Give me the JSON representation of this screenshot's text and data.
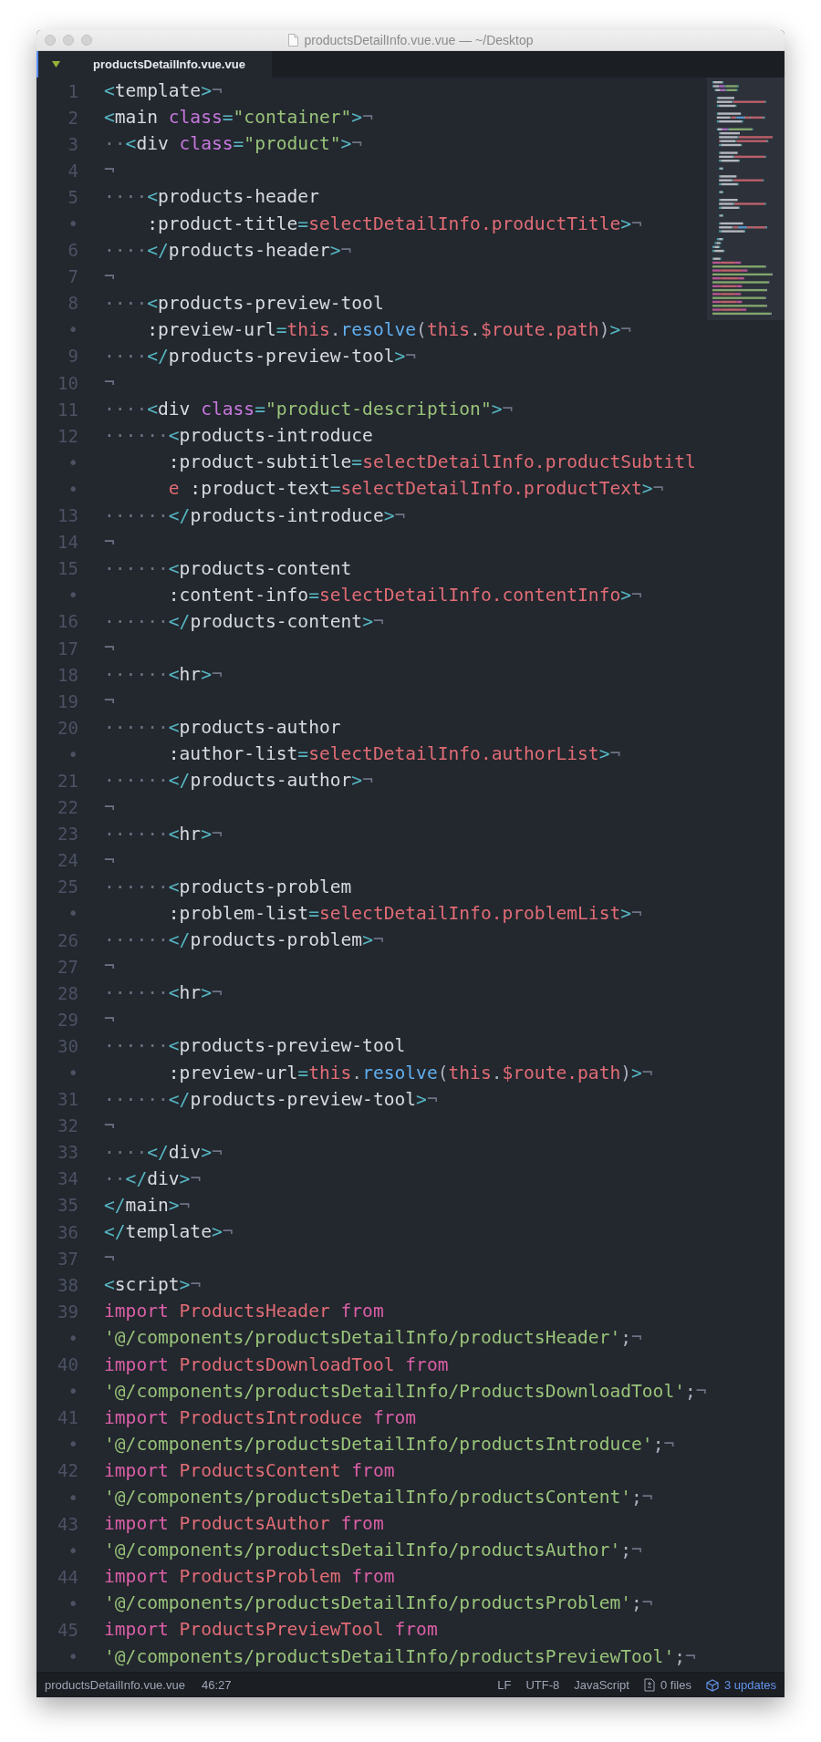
{
  "window": {
    "title": "productsDetailInfo.vue.vue — ~/Desktop"
  },
  "tabs": [
    {
      "label": "productsDetailInfo.vue.vue",
      "selected": true
    }
  ],
  "editor": {
    "rows": [
      {
        "n": "1",
        "c": [
          {
            "text": "<",
            "kind": "p"
          },
          {
            "text": "template",
            "kind": "tag"
          },
          {
            "text": ">",
            "kind": "p"
          },
          {
            "text": "¬",
            "kind": "eol"
          }
        ]
      },
      {
        "n": "2",
        "c": [
          {
            "text": "<",
            "kind": "p"
          },
          {
            "text": "main ",
            "kind": "tag"
          },
          {
            "text": "class",
            "kind": "attr"
          },
          {
            "text": "=",
            "kind": "p"
          },
          {
            "text": "\"container\"",
            "kind": "str"
          },
          {
            "text": ">",
            "kind": "p"
          },
          {
            "text": "¬",
            "kind": "eol"
          }
        ]
      },
      {
        "n": "3",
        "c": [
          {
            "text": "··",
            "kind": "ws"
          },
          {
            "text": "<",
            "kind": "p"
          },
          {
            "text": "div ",
            "kind": "tag"
          },
          {
            "text": "class",
            "kind": "attr"
          },
          {
            "text": "=",
            "kind": "p"
          },
          {
            "text": "\"product\"",
            "kind": "str"
          },
          {
            "text": ">",
            "kind": "p"
          },
          {
            "text": "¬",
            "kind": "eol"
          }
        ]
      },
      {
        "n": "4",
        "c": [
          {
            "text": "¬",
            "kind": "eol"
          }
        ]
      },
      {
        "n": "5",
        "c": [
          {
            "text": "····",
            "kind": "ws"
          },
          {
            "text": "<",
            "kind": "p"
          },
          {
            "text": "products-header",
            "kind": "tag"
          }
        ]
      },
      {
        "n": "•",
        "c": [
          {
            "text": ":product-title",
            "kind": "tag"
          },
          {
            "text": "=",
            "kind": "p"
          },
          {
            "text": "selectDetailInfo.productTitle",
            "kind": "var"
          },
          {
            "text": ">",
            "kind": "p"
          },
          {
            "text": "¬",
            "kind": "eol"
          }
        ]
      },
      {
        "n": "6",
        "c": [
          {
            "text": "····",
            "kind": "ws"
          },
          {
            "text": "</",
            "kind": "p"
          },
          {
            "text": "products-header",
            "kind": "tag"
          },
          {
            "text": ">",
            "kind": "p"
          },
          {
            "text": "¬",
            "kind": "eol"
          }
        ]
      },
      {
        "n": "7",
        "c": [
          {
            "text": "¬",
            "kind": "eol"
          }
        ]
      },
      {
        "n": "8",
        "c": [
          {
            "text": "····",
            "kind": "ws"
          },
          {
            "text": "<",
            "kind": "p"
          },
          {
            "text": "products-preview-tool",
            "kind": "tag"
          }
        ]
      },
      {
        "n": "•",
        "c": [
          {
            "text": ":preview-url",
            "kind": "tag"
          },
          {
            "text": "=",
            "kind": "p"
          },
          {
            "text": "this",
            "kind": "var"
          },
          {
            "text": ".",
            "kind": "txt"
          },
          {
            "text": "resolve",
            "kind": "fn"
          },
          {
            "text": "(",
            "kind": "txt"
          },
          {
            "text": "this",
            "kind": "var"
          },
          {
            "text": ".",
            "kind": "txt"
          },
          {
            "text": "$route.path",
            "kind": "var"
          },
          {
            "text": ")",
            "kind": "txt"
          },
          {
            "text": ">",
            "kind": "p"
          },
          {
            "text": "¬",
            "kind": "eol"
          }
        ]
      },
      {
        "n": "9",
        "c": [
          {
            "text": "····",
            "kind": "ws"
          },
          {
            "text": "</",
            "kind": "p"
          },
          {
            "text": "products-preview-tool",
            "kind": "tag"
          },
          {
            "text": ">",
            "kind": "p"
          },
          {
            "text": "¬",
            "kind": "eol"
          }
        ]
      },
      {
        "n": "10",
        "c": [
          {
            "text": "¬",
            "kind": "eol"
          }
        ]
      },
      {
        "n": "11",
        "c": [
          {
            "text": "····",
            "kind": "ws"
          },
          {
            "text": "<",
            "kind": "p"
          },
          {
            "text": "div ",
            "kind": "tag"
          },
          {
            "text": "class",
            "kind": "attr"
          },
          {
            "text": "=",
            "kind": "p"
          },
          {
            "text": "\"product-description\"",
            "kind": "str"
          },
          {
            "text": ">",
            "kind": "p"
          },
          {
            "text": "¬",
            "kind": "eol"
          }
        ]
      },
      {
        "n": "12",
        "c": [
          {
            "text": "······",
            "kind": "ws"
          },
          {
            "text": "<",
            "kind": "p"
          },
          {
            "text": "products-introduce",
            "kind": "tag"
          }
        ]
      },
      {
        "n": "•",
        "c": [
          {
            "text": ":product-subtitle",
            "kind": "tag"
          },
          {
            "text": "=",
            "kind": "p"
          },
          {
            "text": "selectDetailInfo.productSubtitl",
            "kind": "var"
          }
        ]
      },
      {
        "n": "•",
        "c": [
          {
            "text": "e",
            "kind": "var"
          },
          {
            "text": " :product-text",
            "kind": "tag"
          },
          {
            "text": "=",
            "kind": "p"
          },
          {
            "text": "selectDetailInfo.productText",
            "kind": "var"
          },
          {
            "text": ">",
            "kind": "p"
          },
          {
            "text": "¬",
            "kind": "eol"
          }
        ]
      },
      {
        "n": "13",
        "c": [
          {
            "text": "······",
            "kind": "ws"
          },
          {
            "text": "</",
            "kind": "p"
          },
          {
            "text": "products-introduce",
            "kind": "tag"
          },
          {
            "text": ">",
            "kind": "p"
          },
          {
            "text": "¬",
            "kind": "eol"
          }
        ]
      },
      {
        "n": "14",
        "c": [
          {
            "text": "¬",
            "kind": "eol"
          }
        ]
      },
      {
        "n": "15",
        "c": [
          {
            "text": "······",
            "kind": "ws"
          },
          {
            "text": "<",
            "kind": "p"
          },
          {
            "text": "products-content",
            "kind": "tag"
          }
        ]
      },
      {
        "n": "•",
        "c": [
          {
            "text": ":content-info",
            "kind": "tag"
          },
          {
            "text": "=",
            "kind": "p"
          },
          {
            "text": "selectDetailInfo.contentInfo",
            "kind": "var"
          },
          {
            "text": ">",
            "kind": "p"
          },
          {
            "text": "¬",
            "kind": "eol"
          }
        ]
      },
      {
        "n": "16",
        "c": [
          {
            "text": "······",
            "kind": "ws"
          },
          {
            "text": "</",
            "kind": "p"
          },
          {
            "text": "products-content",
            "kind": "tag"
          },
          {
            "text": ">",
            "kind": "p"
          },
          {
            "text": "¬",
            "kind": "eol"
          }
        ]
      },
      {
        "n": "17",
        "c": [
          {
            "text": "¬",
            "kind": "eol"
          }
        ]
      },
      {
        "n": "18",
        "c": [
          {
            "text": "······",
            "kind": "ws"
          },
          {
            "text": "<",
            "kind": "p"
          },
          {
            "text": "hr",
            "kind": "tag"
          },
          {
            "text": ">",
            "kind": "p"
          },
          {
            "text": "¬",
            "kind": "eol"
          }
        ]
      },
      {
        "n": "19",
        "c": [
          {
            "text": "¬",
            "kind": "eol"
          }
        ]
      },
      {
        "n": "20",
        "c": [
          {
            "text": "······",
            "kind": "ws"
          },
          {
            "text": "<",
            "kind": "p"
          },
          {
            "text": "products-author",
            "kind": "tag"
          }
        ]
      },
      {
        "n": "•",
        "c": [
          {
            "text": ":author-list",
            "kind": "tag"
          },
          {
            "text": "=",
            "kind": "p"
          },
          {
            "text": "selectDetailInfo.authorList",
            "kind": "var"
          },
          {
            "text": ">",
            "kind": "p"
          },
          {
            "text": "¬",
            "kind": "eol"
          }
        ]
      },
      {
        "n": "21",
        "c": [
          {
            "text": "······",
            "kind": "ws"
          },
          {
            "text": "</",
            "kind": "p"
          },
          {
            "text": "products-author",
            "kind": "tag"
          },
          {
            "text": ">",
            "kind": "p"
          },
          {
            "text": "¬",
            "kind": "eol"
          }
        ]
      },
      {
        "n": "22",
        "c": [
          {
            "text": "¬",
            "kind": "eol"
          }
        ]
      },
      {
        "n": "23",
        "c": [
          {
            "text": "······",
            "kind": "ws"
          },
          {
            "text": "<",
            "kind": "p"
          },
          {
            "text": "hr",
            "kind": "tag"
          },
          {
            "text": ">",
            "kind": "p"
          },
          {
            "text": "¬",
            "kind": "eol"
          }
        ]
      },
      {
        "n": "24",
        "c": [
          {
            "text": "¬",
            "kind": "eol"
          }
        ]
      },
      {
        "n": "25",
        "c": [
          {
            "text": "······",
            "kind": "ws"
          },
          {
            "text": "<",
            "kind": "p"
          },
          {
            "text": "products-problem",
            "kind": "tag"
          }
        ]
      },
      {
        "n": "•",
        "c": [
          {
            "text": ":problem-list",
            "kind": "tag"
          },
          {
            "text": "=",
            "kind": "p"
          },
          {
            "text": "selectDetailInfo.problemList",
            "kind": "var"
          },
          {
            "text": ">",
            "kind": "p"
          },
          {
            "text": "¬",
            "kind": "eol"
          }
        ]
      },
      {
        "n": "26",
        "c": [
          {
            "text": "······",
            "kind": "ws"
          },
          {
            "text": "</",
            "kind": "p"
          },
          {
            "text": "products-problem",
            "kind": "tag"
          },
          {
            "text": ">",
            "kind": "p"
          },
          {
            "text": "¬",
            "kind": "eol"
          }
        ]
      },
      {
        "n": "27",
        "c": [
          {
            "text": "¬",
            "kind": "eol"
          }
        ]
      },
      {
        "n": "28",
        "c": [
          {
            "text": "······",
            "kind": "ws"
          },
          {
            "text": "<",
            "kind": "p"
          },
          {
            "text": "hr",
            "kind": "tag"
          },
          {
            "text": ">",
            "kind": "p"
          },
          {
            "text": "¬",
            "kind": "eol"
          }
        ]
      },
      {
        "n": "29",
        "c": [
          {
            "text": "¬",
            "kind": "eol"
          }
        ]
      },
      {
        "n": "30",
        "c": [
          {
            "text": "······",
            "kind": "ws"
          },
          {
            "text": "<",
            "kind": "p"
          },
          {
            "text": "products-preview-tool",
            "kind": "tag"
          }
        ]
      },
      {
        "n": "•",
        "c": [
          {
            "text": ":preview-url",
            "kind": "tag"
          },
          {
            "text": "=",
            "kind": "p"
          },
          {
            "text": "this",
            "kind": "var"
          },
          {
            "text": ".",
            "kind": "txt"
          },
          {
            "text": "resolve",
            "kind": "fn"
          },
          {
            "text": "(",
            "kind": "txt"
          },
          {
            "text": "this",
            "kind": "var"
          },
          {
            "text": ".",
            "kind": "txt"
          },
          {
            "text": "$route.path",
            "kind": "var"
          },
          {
            "text": ")",
            "kind": "txt"
          },
          {
            "text": ">",
            "kind": "p"
          },
          {
            "text": "¬",
            "kind": "eol"
          }
        ]
      },
      {
        "n": "31",
        "c": [
          {
            "text": "······",
            "kind": "ws"
          },
          {
            "text": "</",
            "kind": "p"
          },
          {
            "text": "products-preview-tool",
            "kind": "tag"
          },
          {
            "text": ">",
            "kind": "p"
          },
          {
            "text": "¬",
            "kind": "eol"
          }
        ]
      },
      {
        "n": "32",
        "c": [
          {
            "text": "¬",
            "kind": "eol"
          }
        ]
      },
      {
        "n": "33",
        "c": [
          {
            "text": "····",
            "kind": "ws"
          },
          {
            "text": "</",
            "kind": "p"
          },
          {
            "text": "div",
            "kind": "tag"
          },
          {
            "text": ">",
            "kind": "p"
          },
          {
            "text": "¬",
            "kind": "eol"
          }
        ]
      },
      {
        "n": "34",
        "c": [
          {
            "text": "··",
            "kind": "ws"
          },
          {
            "text": "</",
            "kind": "p"
          },
          {
            "text": "div",
            "kind": "tag"
          },
          {
            "text": ">",
            "kind": "p"
          },
          {
            "text": "¬",
            "kind": "eol"
          }
        ]
      },
      {
        "n": "35",
        "c": [
          {
            "text": "</",
            "kind": "p"
          },
          {
            "text": "main",
            "kind": "tag"
          },
          {
            "text": ">",
            "kind": "p"
          },
          {
            "text": "¬",
            "kind": "eol"
          }
        ]
      },
      {
        "n": "36",
        "c": [
          {
            "text": "</",
            "kind": "p"
          },
          {
            "text": "template",
            "kind": "tag"
          },
          {
            "text": ">",
            "kind": "p"
          },
          {
            "text": "¬",
            "kind": "eol"
          }
        ]
      },
      {
        "n": "37",
        "c": [
          {
            "text": "¬",
            "kind": "eol"
          }
        ]
      },
      {
        "n": "38",
        "c": [
          {
            "text": "<",
            "kind": "p"
          },
          {
            "text": "script",
            "kind": "tag"
          },
          {
            "text": ">",
            "kind": "p"
          },
          {
            "text": "¬",
            "kind": "eol"
          }
        ]
      },
      {
        "n": "39",
        "c": [
          {
            "text": "import ",
            "kind": "kw"
          },
          {
            "text": "ProductsHeader",
            "kind": "var"
          },
          {
            "text": " from",
            "kind": "kw"
          }
        ]
      },
      {
        "n": "•",
        "c": [
          {
            "text": "'@/components/productsDetailInfo/productsHeader'",
            "kind": "str"
          },
          {
            "text": ";",
            "kind": "txt"
          },
          {
            "text": "¬",
            "kind": "eol"
          }
        ]
      },
      {
        "n": "40",
        "c": [
          {
            "text": "import ",
            "kind": "kw"
          },
          {
            "text": "ProductsDownloadTool",
            "kind": "var"
          },
          {
            "text": " from",
            "kind": "kw"
          }
        ]
      },
      {
        "n": "•",
        "c": [
          {
            "text": "'@/components/productsDetailInfo/ProductsDownloadTool'",
            "kind": "str"
          },
          {
            "text": ";",
            "kind": "txt"
          },
          {
            "text": "¬",
            "kind": "eol"
          }
        ]
      },
      {
        "n": "41",
        "c": [
          {
            "text": "import ",
            "kind": "kw"
          },
          {
            "text": "ProductsIntroduce",
            "kind": "var"
          },
          {
            "text": " from",
            "kind": "kw"
          }
        ]
      },
      {
        "n": "•",
        "c": [
          {
            "text": "'@/components/productsDetailInfo/productsIntroduce'",
            "kind": "str"
          },
          {
            "text": ";",
            "kind": "txt"
          },
          {
            "text": "¬",
            "kind": "eol"
          }
        ]
      },
      {
        "n": "42",
        "c": [
          {
            "text": "import ",
            "kind": "kw"
          },
          {
            "text": "ProductsContent",
            "kind": "var"
          },
          {
            "text": " from",
            "kind": "kw"
          }
        ]
      },
      {
        "n": "•",
        "c": [
          {
            "text": "'@/components/productsDetailInfo/productsContent'",
            "kind": "str"
          },
          {
            "text": ";",
            "kind": "txt"
          },
          {
            "text": "¬",
            "kind": "eol"
          }
        ]
      },
      {
        "n": "43",
        "c": [
          {
            "text": "import ",
            "kind": "kw"
          },
          {
            "text": "ProductsAuthor",
            "kind": "var"
          },
          {
            "text": " from",
            "kind": "kw"
          }
        ]
      },
      {
        "n": "•",
        "c": [
          {
            "text": "'@/components/productsDetailInfo/productsAuthor'",
            "kind": "str"
          },
          {
            "text": ";",
            "kind": "txt"
          },
          {
            "text": "¬",
            "kind": "eol"
          }
        ]
      },
      {
        "n": "44",
        "c": [
          {
            "text": "import ",
            "kind": "kw"
          },
          {
            "text": "ProductsProblem",
            "kind": "var"
          },
          {
            "text": " from",
            "kind": "kw"
          }
        ]
      },
      {
        "n": "•",
        "c": [
          {
            "text": "'@/components/productsDetailInfo/productsProblem'",
            "kind": "str"
          },
          {
            "text": ";",
            "kind": "txt"
          },
          {
            "text": "¬",
            "kind": "eol"
          }
        ]
      },
      {
        "n": "45",
        "c": [
          {
            "text": "import ",
            "kind": "kw"
          },
          {
            "text": "ProductsPreviewTool",
            "kind": "var"
          },
          {
            "text": " from",
            "kind": "kw"
          }
        ]
      },
      {
        "n": "•",
        "c": [
          {
            "text": "'@/components/productsDetailInfo/productsPreviewTool'",
            "kind": "str"
          },
          {
            "text": ";",
            "kind": "txt"
          },
          {
            "text": "¬",
            "kind": "eol"
          }
        ]
      }
    ]
  },
  "status_bar": {
    "file": "productsDetailInfo.vue.vue",
    "cursor": "46:27",
    "line_ending": "LF",
    "encoding": "UTF-8",
    "grammar": "JavaScript",
    "files": "0 files",
    "updates": "3 updates"
  }
}
